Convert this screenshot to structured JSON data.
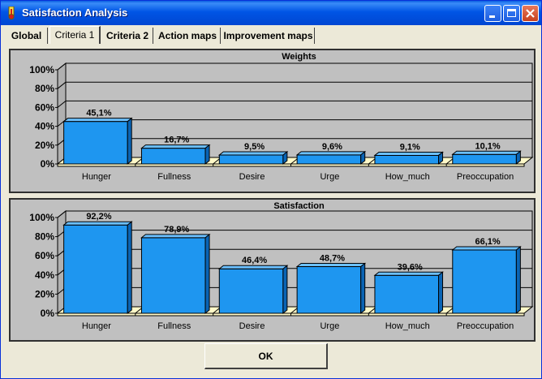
{
  "window": {
    "title": "Satisfaction Analysis"
  },
  "tabs": [
    {
      "label": "Global",
      "active": false
    },
    {
      "label": "Criteria 1",
      "active": true
    },
    {
      "label": "Criteria 2",
      "active": false
    },
    {
      "label": "Action maps",
      "active": false
    },
    {
      "label": "Improvement maps",
      "active": false
    }
  ],
  "buttons": {
    "ok_label": "OK"
  },
  "colors": {
    "bar": "#1e96f0",
    "bar_top": "#6bc0ff",
    "bar_side": "#0a64b4",
    "plot_bg": "#c0c0c0",
    "floor": "#fff9c8"
  },
  "chart_data": [
    {
      "type": "bar",
      "title": "Weights",
      "categories": [
        "Hunger",
        "Fullness",
        "Desire",
        "Urge",
        "How_much",
        "Preoccupation"
      ],
      "values": [
        45.1,
        16.7,
        9.5,
        9.6,
        9.1,
        10.1
      ],
      "value_labels": [
        "45,1%",
        "16,7%",
        "9,5%",
        "9,6%",
        "9,1%",
        "10,1%"
      ],
      "yticks": [
        "0%",
        "20%",
        "40%",
        "60%",
        "80%",
        "100%"
      ],
      "ylim": [
        0,
        100
      ],
      "grid": true
    },
    {
      "type": "bar",
      "title": "Satisfaction",
      "categories": [
        "Hunger",
        "Fullness",
        "Desire",
        "Urge",
        "How_much",
        "Preoccupation"
      ],
      "values": [
        92.2,
        78.9,
        46.4,
        48.7,
        39.6,
        66.1
      ],
      "value_labels": [
        "92,2%",
        "78,9%",
        "46,4%",
        "48,7%",
        "39,6%",
        "66,1%"
      ],
      "yticks": [
        "0%",
        "20%",
        "40%",
        "60%",
        "80%",
        "100%"
      ],
      "ylim": [
        0,
        100
      ],
      "grid": true
    }
  ]
}
